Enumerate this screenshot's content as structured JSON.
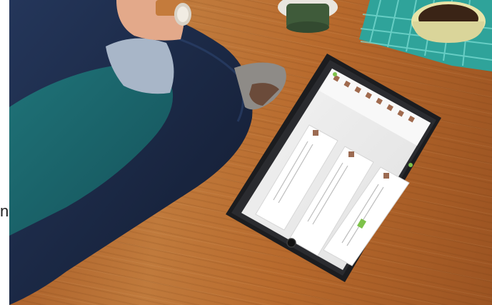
{
  "scene": {
    "left_text_fragment": "n",
    "objects": [
      "person-seated",
      "tablet",
      "coffee-cup",
      "mug",
      "coaster"
    ]
  },
  "colors": {
    "wood": "#b86a2d",
    "sweater": "#1e6a6f",
    "jeans": "#1b2a45",
    "tablet_frame": "#1b1c1f",
    "coaster": "#3cb2a9",
    "accent_green": "#7ec24a"
  }
}
